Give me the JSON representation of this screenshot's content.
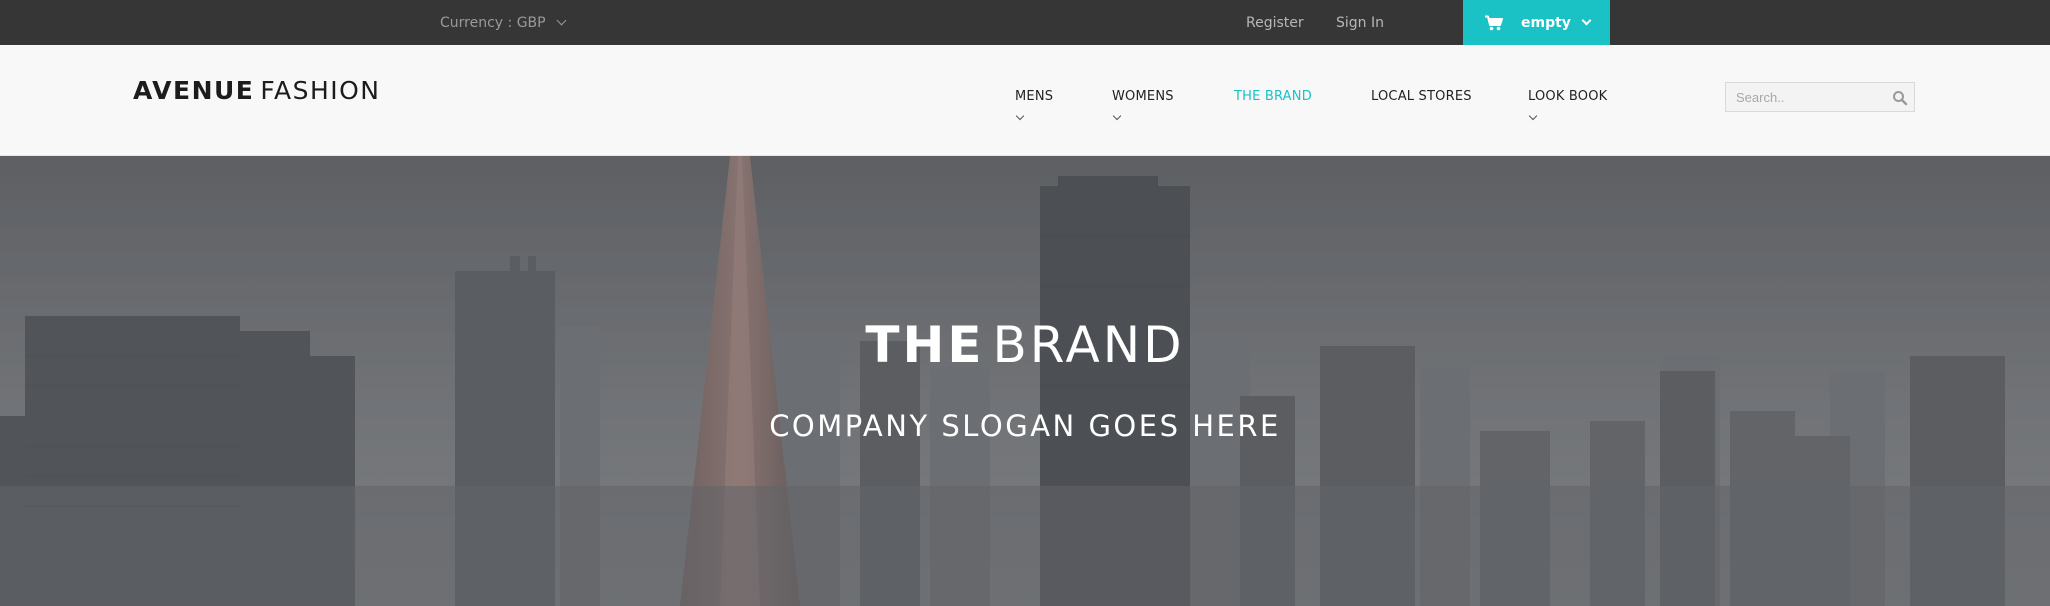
{
  "topbar": {
    "currency_label": "Currency : GBP",
    "register": "Register",
    "signin": "Sign In",
    "cart_label": "empty",
    "cart_icon": "cart-icon",
    "colors": {
      "bar": "#363636",
      "cart_bg": "#1ac2c6"
    }
  },
  "header": {
    "logo_bold": "AVENUE",
    "logo_light": "FASHION",
    "nav": [
      "MENS",
      "WOMENS",
      "THE BRAND",
      "LOCAL STORES",
      "LOOK BOOK"
    ],
    "active_nav": "THE BRAND",
    "search_placeholder": "Search..",
    "search_icon": "search-icon",
    "accent": "#1ac2c6"
  },
  "hero": {
    "title_bold": "THE",
    "title_light": "BRAND",
    "slogan": "COMPANY SLOGAN GOES HERE",
    "background": "city-skyline-image"
  }
}
